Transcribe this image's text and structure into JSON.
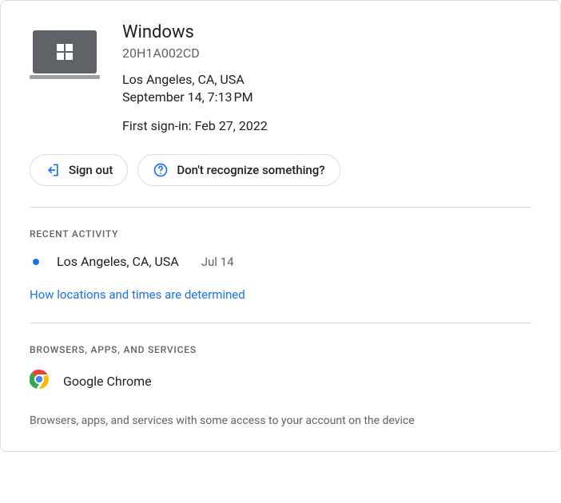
{
  "device": {
    "name": "Windows",
    "model": "20H1A002CD",
    "location": "Los Angeles, CA, USA",
    "last_active": "September 14, 7:13 PM",
    "first_signin": "First sign-in: Feb 27, 2022"
  },
  "actions": {
    "sign_out": "Sign out",
    "dont_recognize": "Don't recognize something?"
  },
  "recent_activity": {
    "heading": "RECENT ACTIVITY",
    "items": [
      {
        "location": "Los Angeles, CA, USA",
        "date": "Jul 14"
      }
    ],
    "link": "How locations and times are determined"
  },
  "browsers": {
    "heading": "BROWSERS, APPS, AND SERVICES",
    "items": [
      {
        "name": "Google Chrome"
      }
    ],
    "description": "Browsers, apps, and services with some access to your account on the device"
  }
}
